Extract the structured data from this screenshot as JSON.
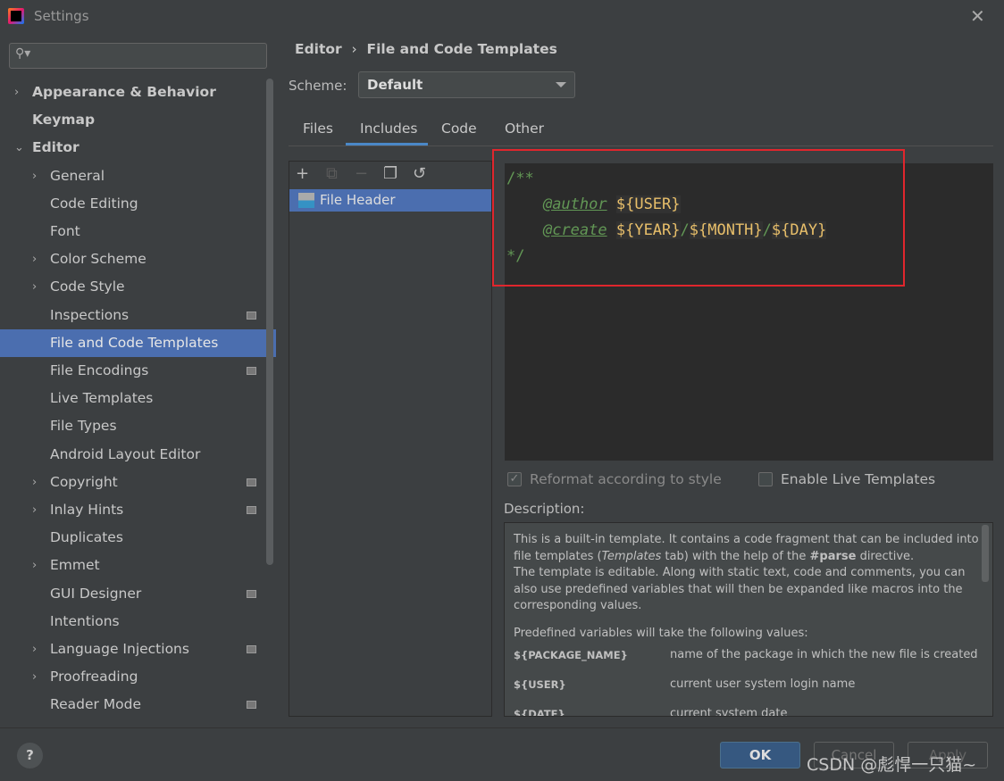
{
  "window": {
    "title": "Settings",
    "close": "✕"
  },
  "sidebar": {
    "search_placeholder": "",
    "items": [
      {
        "label": "Appearance & Behavior",
        "level": 0,
        "arrow": "›",
        "bold": true
      },
      {
        "label": "Keymap",
        "level": 0,
        "bold": true
      },
      {
        "label": "Editor",
        "level": 0,
        "arrow": "⌄",
        "bold": true
      },
      {
        "label": "General",
        "level": 1,
        "arrow": "›"
      },
      {
        "label": "Code Editing",
        "level": 1
      },
      {
        "label": "Font",
        "level": 1
      },
      {
        "label": "Color Scheme",
        "level": 1,
        "arrow": "›"
      },
      {
        "label": "Code Style",
        "level": 1,
        "arrow": "›"
      },
      {
        "label": "Inspections",
        "level": 1,
        "modified": true
      },
      {
        "label": "File and Code Templates",
        "level": 1,
        "selected": true
      },
      {
        "label": "File Encodings",
        "level": 1,
        "modified": true
      },
      {
        "label": "Live Templates",
        "level": 1
      },
      {
        "label": "File Types",
        "level": 1
      },
      {
        "label": "Android Layout Editor",
        "level": 1
      },
      {
        "label": "Copyright",
        "level": 1,
        "arrow": "›",
        "modified": true
      },
      {
        "label": "Inlay Hints",
        "level": 1,
        "arrow": "›",
        "modified": true
      },
      {
        "label": "Duplicates",
        "level": 1
      },
      {
        "label": "Emmet",
        "level": 1,
        "arrow": "›"
      },
      {
        "label": "GUI Designer",
        "level": 1,
        "modified": true
      },
      {
        "label": "Intentions",
        "level": 1
      },
      {
        "label": "Language Injections",
        "level": 1,
        "arrow": "›",
        "modified": true
      },
      {
        "label": "Proofreading",
        "level": 1,
        "arrow": "›"
      },
      {
        "label": "Reader Mode",
        "level": 1,
        "modified": true
      }
    ]
  },
  "breadcrumb": {
    "parent": "Editor",
    "sep": "›",
    "current": "File and Code Templates"
  },
  "scheme": {
    "label": "Scheme:",
    "value": "Default"
  },
  "tabs": [
    "Files",
    "Includes",
    "Code",
    "Other"
  ],
  "active_tab": "Includes",
  "toolbar": {
    "add": "+",
    "copy": "⧉",
    "remove": "−",
    "dup": "❐",
    "reset": "↺"
  },
  "templates": [
    {
      "name": "File Header"
    }
  ],
  "editor": {
    "open": "/**",
    "author_tag": "@author",
    "user_var": "${USER}",
    "create_tag": "@create",
    "year_var": "${YEAR}",
    "slash": "/",
    "month_var": "${MONTH}",
    "day_var": "${DAY}",
    "close": "*/"
  },
  "options": {
    "reformat": "Reformat according to style",
    "reformat_checked": true,
    "live": "Enable Live Templates",
    "live_checked": false
  },
  "description": {
    "label": "Description:",
    "p1a": "This is a built-in template. It contains a code fragment that can be included into file templates (",
    "p1i": "Templates",
    "p1b": " tab) with the help of the ",
    "p1c": "#parse",
    "p1d": " directive.",
    "p2": "The template is editable. Along with static text, code and comments, you can also use predefined variables that will then be expanded like macros into the corresponding values.",
    "p3": "Predefined variables will take the following values:",
    "vars": [
      {
        "k": "${PACKAGE_NAME}",
        "v": "name of the package in which the new file is created"
      },
      {
        "k": "${USER}",
        "v": "current user system login name"
      },
      {
        "k": "${DATE}",
        "v": "current system date"
      }
    ]
  },
  "footer": {
    "help": "?",
    "ok": "OK",
    "cancel": "Cancel",
    "apply": "Apply",
    "watermark": "CSDN @彪悍一只猫~"
  }
}
